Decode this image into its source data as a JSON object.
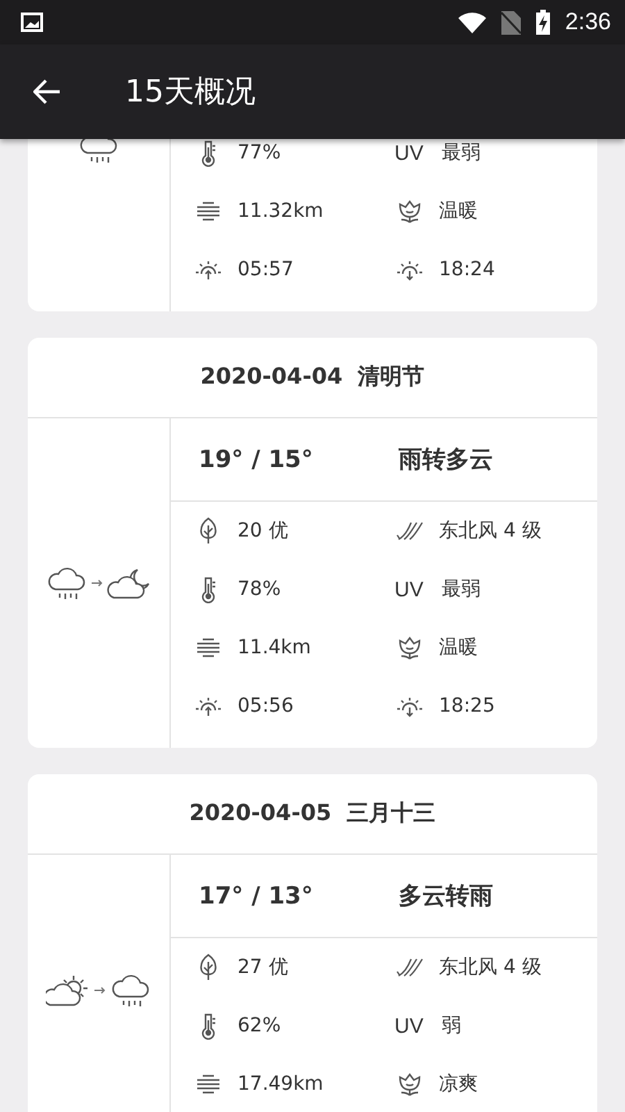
{
  "status_bar": {
    "time": "2:36"
  },
  "app_bar": {
    "title": "15天概况"
  },
  "days": [
    {
      "icons": [
        {
          "kind": "rain"
        }
      ],
      "rows": [
        [
          {
            "kind": "humidity",
            "value": "77%"
          },
          {
            "kind": "uv",
            "label": "UV",
            "value": "最弱"
          }
        ],
        [
          {
            "kind": "visibility",
            "value": "11.32km"
          },
          {
            "kind": "comfort",
            "value": "温暖"
          }
        ],
        [
          {
            "kind": "sunrise",
            "value": "05:57"
          },
          {
            "kind": "sunset",
            "value": "18:24"
          }
        ]
      ]
    },
    {
      "date": "2020-04-04",
      "note": "清明节",
      "icons": [
        {
          "kind": "rain"
        },
        {
          "kind": "cloudy-night"
        }
      ],
      "temps": "19° / 15°",
      "weather": "雨转多云",
      "rows": [
        [
          {
            "kind": "aqi",
            "value": "20 优"
          },
          {
            "kind": "wind",
            "value": "东北风 4 级"
          }
        ],
        [
          {
            "kind": "humidity",
            "value": "78%"
          },
          {
            "kind": "uv",
            "label": "UV",
            "value": "最弱"
          }
        ],
        [
          {
            "kind": "visibility",
            "value": "11.4km"
          },
          {
            "kind": "comfort",
            "value": "温暖"
          }
        ],
        [
          {
            "kind": "sunrise",
            "value": "05:56"
          },
          {
            "kind": "sunset",
            "value": "18:25"
          }
        ]
      ]
    },
    {
      "date": "2020-04-05",
      "note": "三月十三",
      "icons": [
        {
          "kind": "partly-cloudy"
        },
        {
          "kind": "rain"
        }
      ],
      "temps": "17° / 13°",
      "weather": "多云转雨",
      "rows": [
        [
          {
            "kind": "aqi",
            "value": "27 优"
          },
          {
            "kind": "wind",
            "value": "东北风 4 级"
          }
        ],
        [
          {
            "kind": "humidity",
            "value": "62%"
          },
          {
            "kind": "uv",
            "label": "UV",
            "value": "弱"
          }
        ],
        [
          {
            "kind": "visibility",
            "value": "17.49km"
          },
          {
            "kind": "comfort",
            "value": "凉爽"
          }
        ]
      ]
    }
  ]
}
